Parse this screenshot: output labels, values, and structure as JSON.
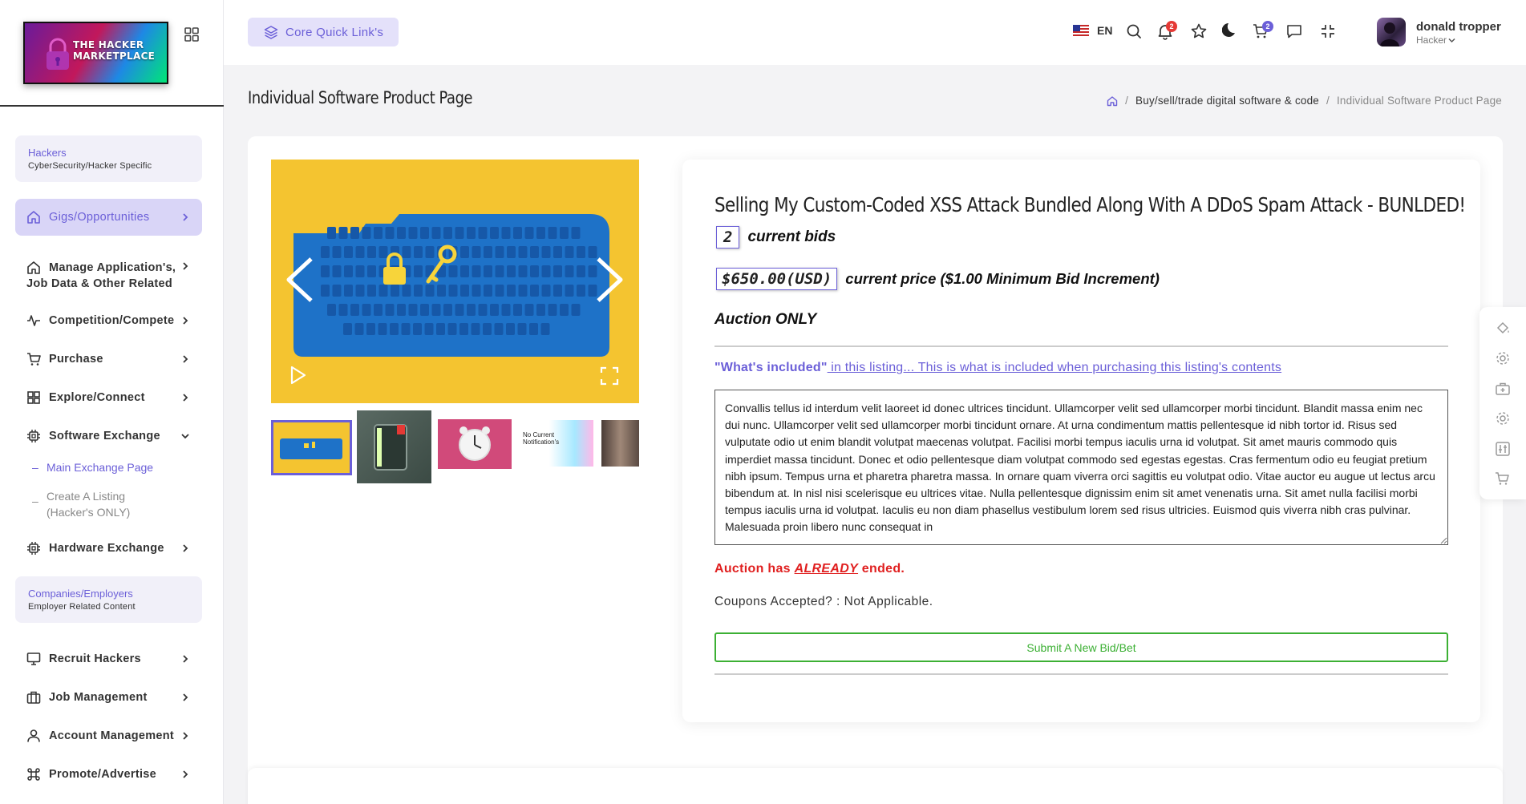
{
  "sidebar": {
    "logo_text": "THE HACKER MARKETPLACE",
    "sections": {
      "hackers": {
        "title": "Hackers",
        "subtitle": "CyberSecurity/Hacker Specific"
      },
      "companies": {
        "title": "Companies/Employers",
        "subtitle": "Employer Related Content"
      }
    },
    "items": {
      "gigs": "Gigs/Opportunities",
      "manage": "Manage Application's, Job Data & Other Related",
      "competition": "Competition/Compete",
      "purchase": "Purchase",
      "explore": "Explore/Connect",
      "software": "Software Exchange",
      "hardware": "Hardware Exchange",
      "recruit": "Recruit Hackers",
      "job_mgmt": "Job Management",
      "account": "Account Management",
      "promote": "Promote/Advertise"
    },
    "sub_items": {
      "main_exchange": "Main Exchange Page",
      "create_listing": "Create A Listing (Hacker's ONLY)"
    }
  },
  "header": {
    "quick_links": "Core Quick Link's",
    "language": "EN",
    "notifications_count": "2",
    "cart_count": "2",
    "user_name": "donald tropper",
    "user_role": "Hacker"
  },
  "page": {
    "title": "Individual Software Product Page",
    "breadcrumb": {
      "parent": "Buy/sell/trade digital software & code",
      "current": "Individual Software Product Page"
    }
  },
  "product": {
    "title": "Selling My Custom-Coded XSS Attack Bundled Along With A DDoS Spam Attack - BUNLDED!",
    "bid_count": "2",
    "bids_label": "current bids",
    "price": "$650.00(USD)",
    "price_label": "current price ($1.00 Minimum Bid Increment)",
    "auction_type": "Auction ONLY",
    "included_quoted": "\"What's included\"",
    "included_rest": " in this listing... This is what is included when purchasing this listing's contents",
    "description": "Convallis tellus id interdum velit laoreet id donec ultrices tincidunt. Ullamcorper velit sed ullamcorper morbi tincidunt. Blandit massa enim nec dui nunc. Ullamcorper velit sed ullamcorper morbi tincidunt ornare. At urna condimentum mattis pellentesque id nibh tortor id. Risus sed vulputate odio ut enim blandit volutpat maecenas volutpat. Facilisi morbi tempus iaculis urna id volutpat. Sit amet mauris commodo quis imperdiet massa tincidunt. Donec et odio pellentesque diam volutpat commodo sed egestas egestas. Cras fermentum odio eu feugiat pretium nibh ipsum. Tempus urna et pharetra pharetra massa. In ornare quam viverra orci sagittis eu volutpat odio. Vitae auctor eu augue ut lectus arcu bibendum at. In nisl nisi scelerisque eu ultrices vitae. Nulla pellentesque dignissim enim sit amet venenatis urna. Sit amet nulla facilisi morbi tempus iaculis urna id volutpat. Iaculis eu non diam phasellus vestibulum lorem sed risus ultricies. Euismod quis viverra nibh cras pulvinar. Malesuada proin libero nunc consequat in",
    "ended_prefix": "Auction has ",
    "ended_emph": "ALREADY",
    "ended_suffix": " ended.",
    "coupons": "Coupons Accepted? : Not Applicable.",
    "submit_bid": "Submit A New Bid/Bet"
  },
  "thumbnails": {
    "notification_text": "No Current Notification's"
  },
  "colors": {
    "accent": "#6b5fd8",
    "danger": "#e02020",
    "success": "#3cb034",
    "gallery_bg": "#f4c430"
  }
}
